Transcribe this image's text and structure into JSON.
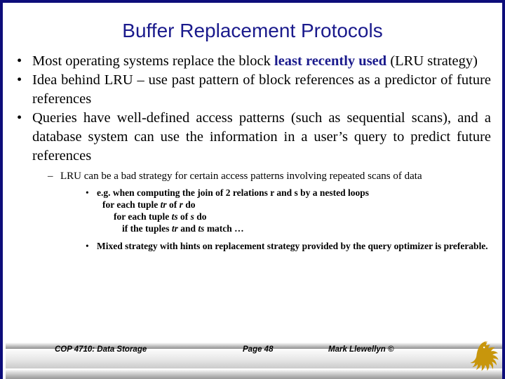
{
  "slide": {
    "title": "Buffer Replacement Protocols",
    "title_color": "#1a1a8c",
    "border_color": "#0d0d7a",
    "accent_color": "#1a1a8c",
    "logo_color": "#c8960c",
    "background": "#ffffff"
  },
  "bullets": {
    "b1_marker": "•",
    "b1_pre": "Most operating systems replace the block ",
    "b1_highlight": "least recently used",
    "b1_post": " (LRU strategy)",
    "b2_marker": "•",
    "b2_text": "Idea behind LRU – use past pattern of block references as a predictor of future references",
    "b3_marker": "•",
    "b3_text": "Queries have well-defined access patterns (such as sequential scans), and a database system can use the information in a user’s query to predict future references",
    "b4_marker": "–",
    "b4_text": "LRU can be a bad strategy for certain access patterns involving repeated scans of data",
    "b5_marker": "•",
    "b5_text": "e.g. when computing the join of 2 relations r and s by a nested loops",
    "b6_marker": "•",
    "b6_text": "Mixed strategy with hints on replacement strategy provided by the query optimizer is preferable."
  },
  "pseudocode": {
    "line1_a": "for each tuple ",
    "line1_v1": "tr",
    "line1_b": " of ",
    "line1_v2": "r",
    "line1_c": " do",
    "line2_a": "for each tuple ",
    "line2_v1": "ts",
    "line2_b": " of ",
    "line2_v2": "s",
    "line2_c": " do",
    "line3_a": "if the tuples ",
    "line3_v1": "tr",
    "line3_b": " and ",
    "line3_v2": "ts",
    "line3_c": " match …"
  },
  "footer": {
    "course": "COP 4710: Data Storage",
    "page": "Page 48",
    "author": "Mark Llewellyn ©"
  }
}
